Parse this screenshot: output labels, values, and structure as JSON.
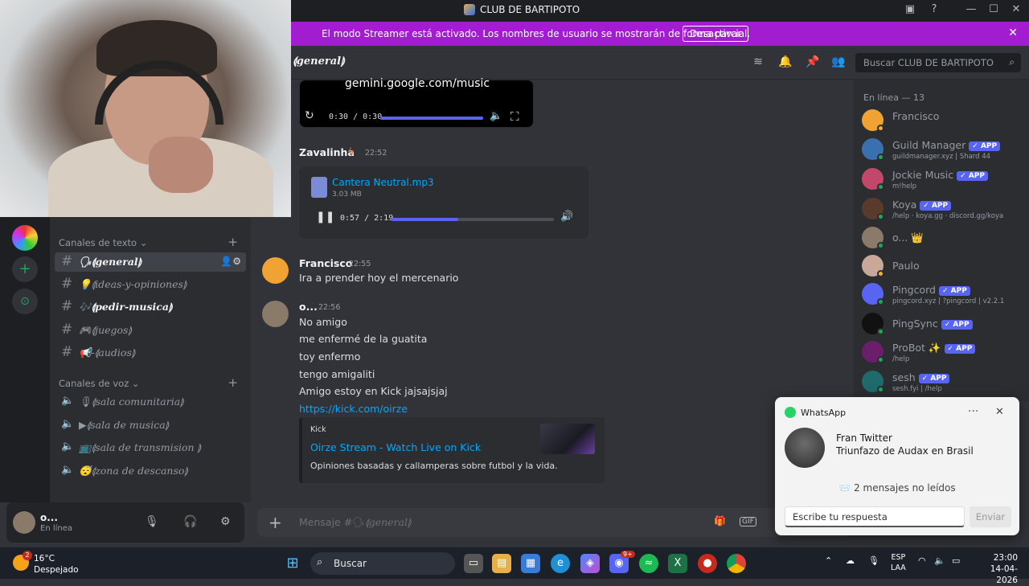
{
  "window": {
    "title": "CLUB DE BARTIPOTO"
  },
  "banner": {
    "text": "El modo Streamer está activado. Los nombres de usuario se mostrarán de forma parcial.",
    "button": "Desactivar"
  },
  "header": {
    "channel": "⟬general⟭",
    "search_placeholder": "Buscar CLUB DE BARTIPOTO"
  },
  "sidebar": {
    "text_category": "Canales de texto",
    "voice_category": "Canales de voz",
    "text_channels": [
      {
        "label": "🗣⟬general⟭"
      },
      {
        "label": "💡⟬ideas-y-opiniones⟭"
      },
      {
        "label": "🎶⟬pedir-musica⟭"
      },
      {
        "label": "🎮⟬juegos⟭"
      },
      {
        "label": "📢-⟬audios⟭"
      }
    ],
    "voice_channels": [
      {
        "label": "🎙⟬sala comunitaria⟭"
      },
      {
        "label": "▶⟬sala de musica⟭"
      },
      {
        "label": "📺⟬sala de transmision ⟭"
      },
      {
        "label": "😴⟬zona de descanso⟭"
      }
    ]
  },
  "user": {
    "name": "o...",
    "status": "En línea"
  },
  "chat": {
    "top_embed_text": "gemini.google.com/music",
    "top_player_time": "0:30 / 0:30",
    "top_player_progress": 1.0,
    "msg1": {
      "author": "Zavalinha",
      "time": "22:52",
      "file_name": "Cantera Neutral.mp3",
      "file_size": "3.03 MB",
      "player_time": "0:57 / 2:19",
      "player_progress": 0.41
    },
    "msg2": {
      "author": "Francisco",
      "time": "22:55",
      "lines": [
        "Ira a prender hoy el mercenario"
      ]
    },
    "msg3": {
      "author": "o...",
      "time": "22:56",
      "lines": [
        "No amigo",
        "me enfermé de la guatita",
        "toy enfermo",
        "tengo amigaliti",
        "Amigo estoy en Kick jajsajsjaj"
      ],
      "link": "https://kick.com/oirze"
    },
    "embed": {
      "provider": "Kick",
      "title": "Oirze Stream - Watch Live on Kick",
      "description": "Opiniones basadas y callamperas sobre futbol y la vida."
    }
  },
  "composer": {
    "placeholder_prefix": "Mensaje #🗣",
    "placeholder_channel": "⟬general⟭"
  },
  "members": {
    "header": "En línea — 13",
    "list": [
      {
        "name": "Francisco",
        "sub": "",
        "app": false,
        "color": "#f0a232"
      },
      {
        "name": "Guild Manager",
        "sub": "guildmanager.xyz | Shard 44",
        "app": true,
        "color": "#3a6fb0"
      },
      {
        "name": "Jockie Music",
        "sub": "m!help",
        "app": true,
        "color": "#c2486b"
      },
      {
        "name": "Koya",
        "sub": "/help · koya.gg · discord.gg/koya",
        "app": true,
        "color": "#5a3a2a"
      },
      {
        "name": "o... 👑",
        "sub": "",
        "app": false,
        "color": "#8a7a6a"
      },
      {
        "name": "Paulo",
        "sub": "",
        "app": false,
        "color": "#c9a89a"
      },
      {
        "name": "Pingcord",
        "sub": "pingcord.xyz | ?pingcord | v2.2.1",
        "app": true,
        "color": "#5865f2"
      },
      {
        "name": "PingSync",
        "sub": "",
        "app": true,
        "color": "#111111"
      },
      {
        "name": "ProBot ✨",
        "sub": "/help",
        "app": true,
        "color": "#6b1f6b"
      },
      {
        "name": "sesh",
        "sub": "sesh.fyi | /help",
        "app": true,
        "color": "#1f6b6b"
      }
    ],
    "app_badge": "✓ APP"
  },
  "toast": {
    "app": "WhatsApp",
    "from": "Fran Twitter",
    "body": "Triunfazo de Audax en Brasil",
    "unread": "📨  2 mensajes no leídos",
    "reply_placeholder": "Escribe tu respuesta",
    "send": "Enviar"
  },
  "taskbar": {
    "temp": "16°C",
    "condition": "Despejado",
    "search": "Buscar",
    "lang": "ESP",
    "layout": "LAA",
    "time": "23:00",
    "date": "14-04-2026",
    "badge": "2",
    "discord_badge": "9+"
  }
}
